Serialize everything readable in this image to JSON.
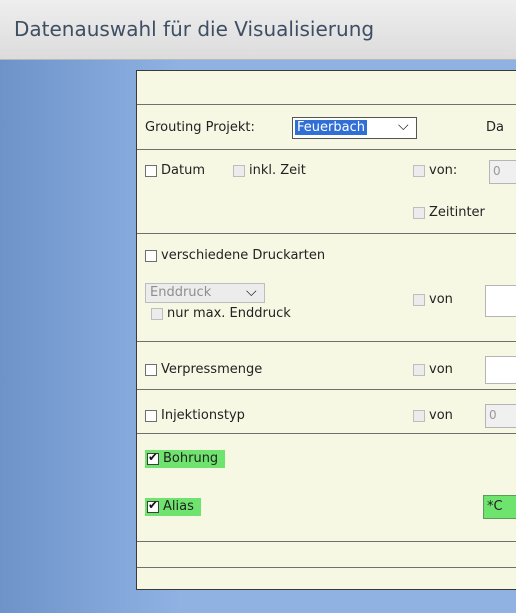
{
  "window": {
    "title": "Datenauswahl für die Visualisierung"
  },
  "project": {
    "label": "Grouting Projekt:",
    "selected": "Feuerbach",
    "cut_label": "Da"
  },
  "date": {
    "datum_label": "Datum",
    "inkl_zeit_label": "inkl. Zeit",
    "von_label": "von:",
    "von_value": "0",
    "zeitinter_label": "Zeitinter"
  },
  "druckarten": {
    "label": "verschiedene Druckarten",
    "select_value": "Enddruck",
    "max_label": "nur max. Enddruck",
    "von_label": "von"
  },
  "verpressmenge": {
    "label": "Verpressmenge",
    "von_label": "von"
  },
  "injektionstyp": {
    "label": "Injektionstyp",
    "von_label": "von",
    "von_value": "0"
  },
  "bohrung": {
    "label": "Bohrung"
  },
  "alias": {
    "label": "Alias",
    "value": "*C"
  },
  "colors": {
    "blue": "#8fb2e3",
    "panel": "#f6f8e4",
    "highlight": "#6ee36e",
    "select": "#2f6fd6"
  }
}
